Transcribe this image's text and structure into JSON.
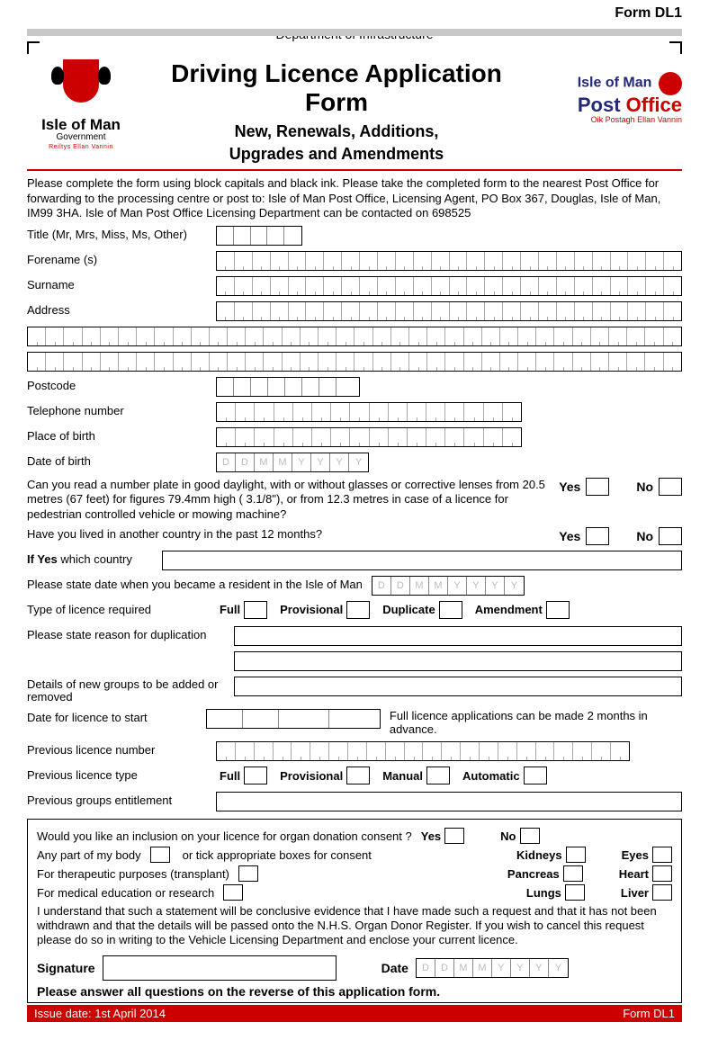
{
  "form_id": "Form DL1",
  "department": "Department of Infrastructure",
  "logo_left": {
    "line1": "Isle of Man",
    "line2": "Government",
    "tagline": "Reiltys Ellan Vannin"
  },
  "title": "Driving Licence Application Form",
  "subtitle1": "New, Renewals, Additions,",
  "subtitle2": "Upgrades and Amendments",
  "logo_right": {
    "line1": "Isle of Man",
    "line2_a": "Post ",
    "line2_b": "Office",
    "tagline": "Oik Postagh Ellan Vannin"
  },
  "intro": "Please complete the form using block capitals and black ink. Please take the completed form to the nearest Post Office for forwarding to the processing centre or post to: Isle of Man Post Office, Licensing Agent, PO Box 367, Douglas, Isle of Man, IM99 3HA.  Isle of Man Post Office Licensing Department can be contacted on 698525",
  "fields": {
    "title": "Title (Mr, Mrs, Miss, Ms, Other)",
    "forename": "Forename (s)",
    "surname": "Surname",
    "address": "Address",
    "postcode": "Postcode",
    "telephone": "Telephone number",
    "pob": "Place of birth",
    "dob": "Date of birth"
  },
  "dob_hint": [
    "D",
    "D",
    "M",
    "M",
    "Y",
    "Y",
    "Y",
    "Y"
  ],
  "q_eyesight": "Can you read a number plate in good daylight, with or without glasses or corrective lenses from 20.5 metres (67 feet) for figures 79.4mm high ( 3.1/8\"), or from 12.3 metres in case of a licence for pedestrian controlled vehicle or mowing machine?",
  "q_abroad": "Have you lived in another country in the past 12 months?",
  "if_yes_country": "If Yes which country",
  "resident_date": "Please state date when you became a resident in the Isle of Man",
  "licence_type_label": "Type of licence required",
  "licence_types": [
    "Full",
    "Provisional",
    "Duplicate",
    "Amendment"
  ],
  "reason_dup": "Please state reason for duplication",
  "new_groups": "Details of new groups to be added or removed",
  "licence_start": "Date for licence to start",
  "licence_start_note": "Full licence applications can be made 2 months in advance.",
  "prev_num": "Previous licence number",
  "prev_type": "Previous licence type",
  "prev_types": [
    "Full",
    "Provisional",
    "Manual",
    "Automatic"
  ],
  "prev_groups": "Previous groups entitlement",
  "yes": "Yes",
  "no": "No",
  "if_yes": "If Yes",
  "organ": {
    "q1": "Would you like an inclusion on your licence for organ donation consent ?",
    "any_part": "Any part of my body",
    "tick_note": "or tick appropriate boxes for consent",
    "therapeutic": "For therapeutic purposes (transplant)",
    "medical": "For medical education or research",
    "organs_l": [
      "Kidneys",
      "Pancreas",
      "Lungs"
    ],
    "organs_r": [
      "Eyes",
      "Heart",
      "Liver"
    ],
    "disclaimer": "I understand that such a statement will be conclusive evidence that I have made such a request and that it has not been withdrawn and that the details will be passed onto the N.H.S. Organ Donor Register. If you wish to cancel this request please do so in writing to the Vehicle Licensing Department and enclose your current licence."
  },
  "signature": "Signature",
  "date": "Date",
  "answer_reverse": "Please answer all questions on the reverse of this application form.",
  "issue_date": "Issue date: 1st April 2014",
  "footer_form": "Form DL1"
}
